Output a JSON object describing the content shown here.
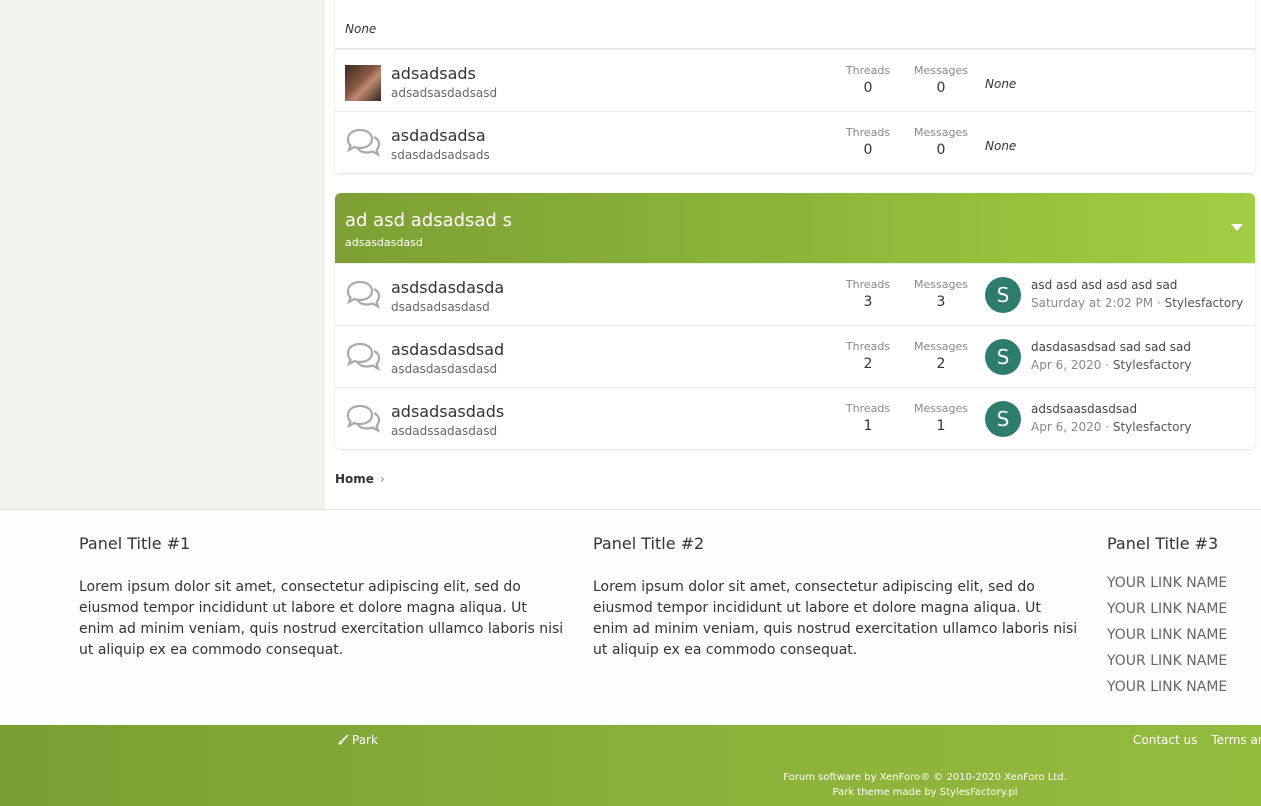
{
  "forum_block_1": {
    "top_latest": "None",
    "nodes": [
      {
        "title": "adsadsads",
        "description": "adsadsasdadsasd",
        "threads_label": "Threads",
        "threads": "0",
        "messages_label": "Messages",
        "messages": "0",
        "latest": "None",
        "icon": "user-photo-avatar"
      },
      {
        "title": "asdadsadsa",
        "description": "sdasdadsadsads",
        "threads_label": "Threads",
        "threads": "0",
        "messages_label": "Messages",
        "messages": "0",
        "latest": "None",
        "icon": "chat-bubbles-icon"
      }
    ]
  },
  "category": {
    "title": "ad asd adsadsad s",
    "description": "adsasdasdasd",
    "color": "#8db83a",
    "nodes": [
      {
        "title": "asdsdasdasda",
        "description": "dsadsadsasdasd",
        "threads_label": "Threads",
        "threads": "3",
        "messages_label": "Messages",
        "messages": "3",
        "avatar_letter": "S",
        "latest_title": "asd asd asd asd asd sad",
        "latest_date": "Saturday at 2:02 PM",
        "latest_sep": " · ",
        "latest_user": "Stylesfactory"
      },
      {
        "title": "asdasdasdsad",
        "description": "asdasdasdasdasd",
        "threads_label": "Threads",
        "threads": "2",
        "messages_label": "Messages",
        "messages": "2",
        "avatar_letter": "S",
        "latest_title": "dasdasasdsad sad sad sad",
        "latest_date": "Apr 6, 2020",
        "latest_sep": " · ",
        "latest_user": "Stylesfactory"
      },
      {
        "title": "adsadsasdads",
        "description": "asdadssadasdasd",
        "threads_label": "Threads",
        "threads": "1",
        "messages_label": "Messages",
        "messages": "1",
        "avatar_letter": "S",
        "latest_title": "adsdsaasdasdsad",
        "latest_date": "Apr 6, 2020",
        "latest_sep": " · ",
        "latest_user": "Stylesfactory"
      }
    ]
  },
  "breadcrumb": {
    "home": "Home",
    "chevron": "›"
  },
  "panels": [
    {
      "title": "Panel Title #1",
      "text": "Lorem ipsum dolor sit amet, consectetur adipiscing elit, sed do eiusmod tempor incididunt ut labore et dolore magna aliqua. Ut enim ad minim veniam, quis nostrud exercitation ullamco laboris nisi ut aliquip ex ea commodo consequat."
    },
    {
      "title": "Panel Title #2",
      "text": "Lorem ipsum dolor sit amet, consectetur adipiscing elit, sed do eiusmod tempor incididunt ut labore et dolore magna aliqua. Ut enim ad minim veniam, quis nostrud exercitation ullamco laboris nisi ut aliquip ex ea commodo consequat."
    },
    {
      "title": "Panel Title #3",
      "links": [
        "YOUR LINK NAME",
        "YOUR LINK NAME",
        "YOUR LINK NAME",
        "YOUR LINK NAME",
        "YOUR LINK NAME"
      ]
    }
  ],
  "footer": {
    "style_chooser": "Park",
    "links": [
      "Contact us",
      "Terms and rules"
    ],
    "copyright_line1": "Forum software by XenForo® © 2010-2020 XenForo Ltd.",
    "copyright_line2": "Park theme made by StylesFactory.pl",
    "bar_color": "#8cb23a"
  },
  "colors": {
    "avatar_teal": "#2d7d6f",
    "gutter": "#f2f1ee"
  }
}
